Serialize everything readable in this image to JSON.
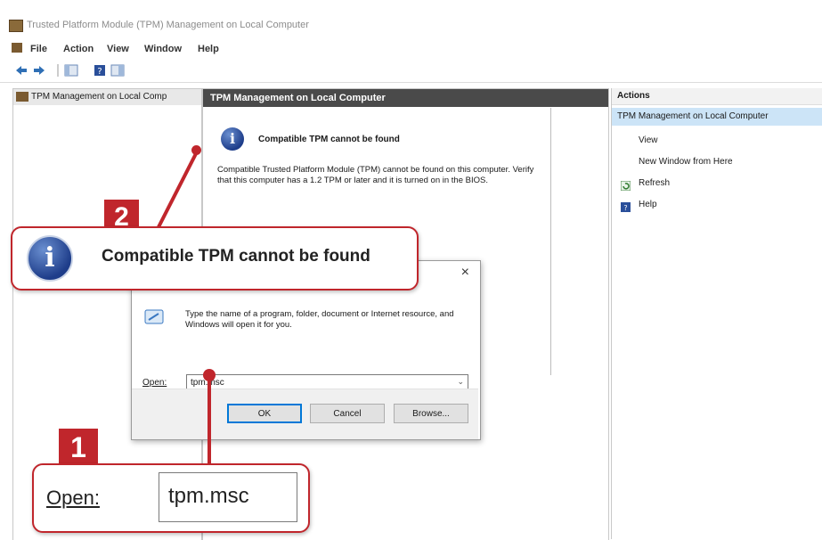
{
  "window": {
    "title": "Trusted Platform Module (TPM) Management on Local Computer"
  },
  "menu": [
    "File",
    "Action",
    "View",
    "Window",
    "Help"
  ],
  "toolbar": {
    "icons": [
      "back-arrow-icon",
      "forward-arrow-icon",
      "console-tree-icon",
      "help-icon",
      "properties-icon"
    ]
  },
  "tree": {
    "root_label": "TPM Management on Local Comp"
  },
  "center": {
    "header": "TPM Management on Local Computer",
    "info_title": "Compatible TPM cannot be found",
    "info_body": "Compatible Trusted Platform Module (TPM) cannot be found on this computer. Verify that this computer has a 1.2 TPM or later and it is turned on in the BIOS."
  },
  "actions": {
    "header": "Actions",
    "selected": "TPM Management on Local Computer",
    "items": [
      {
        "label": "View",
        "icon": ""
      },
      {
        "label": "New Window from Here",
        "icon": ""
      },
      {
        "label": "Refresh",
        "icon": "refresh-icon"
      },
      {
        "label": "Help",
        "icon": "help-icon"
      }
    ]
  },
  "run_dialog": {
    "close": "×",
    "description": "Type the name of a program, folder, document or Internet resource, and Windows will open it for you.",
    "open_label": "Open:",
    "open_value": "tpm.msc",
    "ok_label": "OK",
    "cancel_label": "Cancel",
    "browse_label": "Browse..."
  },
  "callouts": {
    "step1_number": "1",
    "step1_label": "Open:",
    "step1_value": "tpm.msc",
    "step2_number": "2",
    "step2_text": "Compatible TPM cannot be found"
  },
  "colors": {
    "accent": "#c0262c",
    "header_dark": "#4a4a4a",
    "selection": "#cce4f7",
    "info_blue": "#1e3d8a"
  }
}
